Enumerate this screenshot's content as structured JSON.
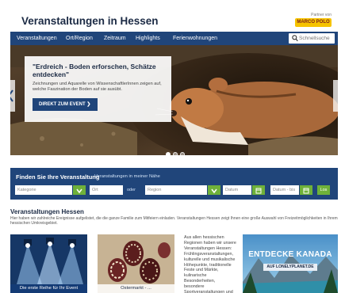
{
  "header": {
    "site_title": "Veranstaltungen in Hessen",
    "partner_label": "Partner von",
    "partner_logo_text": "MARCO POLO"
  },
  "nav": {
    "items": [
      "Veranstaltungen",
      "Ort/Region",
      "Zeitraum",
      "Highlights",
      "Ferienwohnungen"
    ],
    "search_placeholder": "Schnellsuche"
  },
  "hero": {
    "title": "\"Erdreich - Boden erforschen, Schätze entdecken\"",
    "text": "Zeichnungen und Aquarelle von WissenschaftlerInnen zeigen auf, welche Faszination der Boden auf sie ausübt.",
    "button": "DIREKT ZUM EVENT",
    "slides": 3,
    "active_slide": 1
  },
  "finder": {
    "title": "Finden Sie Ihre Veranstaltung",
    "subtitle": "Veranstaltungen in meiner Nähe",
    "category": "Kategorie",
    "place": "Ort",
    "or_label": "oder",
    "region": "Region",
    "date_from": "Datum",
    "date_to": "Datum - bis",
    "go": "Los"
  },
  "section": {
    "title": "Veranstaltungen Hessen",
    "text": "Hier haben wir zahlreiche Ereignisse aufgelistet, die die ganze Familie zum Mitfeiern einladen. Veranstaltungen Hessen zeigt Ihnen eine große Auswahl von Freizeitmöglichkeiten in Ihrem hessischen Umkreisgebiet.",
    "tiles": [
      {
        "caption": "Die erste Reihe für Ihr Event"
      },
      {
        "caption": "Ostermarkt - ..."
      }
    ],
    "side_text": "Aus allen hessischen Regionen haben wir unsere Veranstaltungen Hessen: Frühlingsveranstaltungen, kulturelle und musikalische Höhepunkte, traditionelle Feste und Märkte, kulinarische Besonderheiten, besondere Sportveranstaltungen und viele"
  },
  "ad": {
    "title": "ENTDECKE KANADA",
    "button": "AUF LONELYPLANET.DE"
  },
  "colors": {
    "nav": "#20457a",
    "accent_green": "#6fb13a",
    "partner_yellow": "#f6c300"
  }
}
